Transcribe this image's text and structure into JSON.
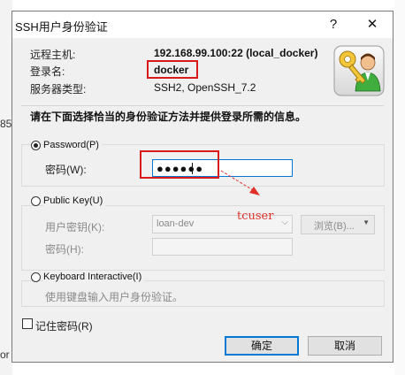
{
  "window": {
    "title": "SSH用户身份验证",
    "help_glyph": "?",
    "close_glyph": "✕"
  },
  "background": {
    "fragment_1": "85",
    "fragment_2": "or"
  },
  "info": {
    "remote_host_label": "远程主机:",
    "remote_host_value": "192.168.99.100:22 (local_docker)",
    "login_label": "登录名:",
    "login_value": "docker",
    "server_type_label": "服务器类型:",
    "server_type_value": "SSH2, OpenSSH_7.2"
  },
  "prompt": "请在下面选择恰当的身份验证方法并提供登录所需的信息。",
  "password_method": {
    "label": "Password(P)",
    "selected": true,
    "password_label": "密码(W):",
    "password_mask": "●●●●●●"
  },
  "publickey_method": {
    "label": "Public Key(U)",
    "selected": false,
    "user_key_label": "用户密钥(K):",
    "user_key_value": "loan-dev",
    "browse_label": "浏览(B)...",
    "passphrase_label": "密码(H):"
  },
  "keyboard_method": {
    "label": "Keyboard Interactive(I)",
    "selected": false,
    "description": "使用键盘输入用户身份验证。"
  },
  "remember_password": {
    "label": "记住密码(R)",
    "checked": false
  },
  "buttons": {
    "ok": "确定",
    "cancel": "取消"
  },
  "annotation": {
    "text": "tcuser",
    "color": "#e0302a"
  },
  "colors": {
    "highlight_box": "#d91a1a",
    "focus_border": "#0078d7"
  }
}
